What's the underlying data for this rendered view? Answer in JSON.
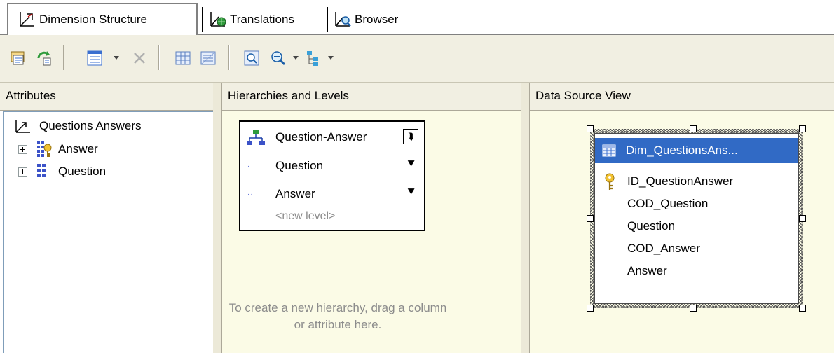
{
  "tabs": [
    {
      "label": "Dimension Structure",
      "icon": "dimension-structure-icon",
      "active": true
    },
    {
      "label": "Translations",
      "icon": "translations-icon",
      "active": false
    },
    {
      "label": "Browser",
      "icon": "browser-icon",
      "active": false
    }
  ],
  "toolbar": {
    "icons": [
      "process-icon",
      "reconnect-icon",
      "view-icon",
      "delete-icon",
      "show-grid-icon",
      "show-list-icon",
      "zoom-fit-icon",
      "zoom-icon",
      "arrange-icon"
    ]
  },
  "attributes": {
    "header": "Attributes",
    "root": "Questions Answers",
    "items": [
      {
        "label": "Answer",
        "icon": "key-attribute-icon"
      },
      {
        "label": "Question",
        "icon": "attribute-icon"
      }
    ]
  },
  "hierarchies": {
    "header": "Hierarchies and Levels",
    "hierarchy_name": "Question-Answer",
    "levels": [
      {
        "label": "Question",
        "dots": "·"
      },
      {
        "label": "Answer",
        "dots": "··"
      }
    ],
    "new_level": "<new level>",
    "hint": "To create a new hierarchy, drag a column or attribute here."
  },
  "dsv": {
    "header": "Data Source View",
    "table_name": "Dim_QuestionsAns...",
    "columns": [
      {
        "label": "ID_QuestionAnswer",
        "key": true
      },
      {
        "label": "COD_Question",
        "key": false
      },
      {
        "label": "Question",
        "key": false
      },
      {
        "label": "COD_Answer",
        "key": false
      },
      {
        "label": "Answer",
        "key": false
      }
    ]
  },
  "colors": {
    "chrome": "#f1efe2",
    "selection": "#316ac5",
    "pane_bg": "#fbfbe6",
    "hint_text": "#8c8c8c"
  }
}
